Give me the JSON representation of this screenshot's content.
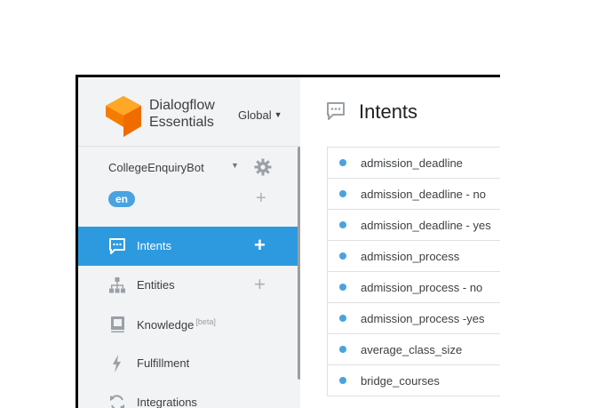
{
  "brand": {
    "line1": "Dialogflow",
    "line2": "Essentials",
    "region": "Global"
  },
  "agent": {
    "name": "CollegeEnquiryBot",
    "language": "en"
  },
  "nav": [
    {
      "label": "Intents",
      "beta": "",
      "icon": "speech-bubble-icon",
      "has_add": true,
      "active": true
    },
    {
      "label": "Entities",
      "beta": "",
      "icon": "hierarchy-icon",
      "has_add": true,
      "active": false
    },
    {
      "label": "Knowledge",
      "beta": "[beta]",
      "icon": "book-icon",
      "has_add": false,
      "active": false
    },
    {
      "label": "Fulfillment",
      "beta": "",
      "icon": "lightning-icon",
      "has_add": false,
      "active": false
    },
    {
      "label": "Integrations",
      "beta": "",
      "icon": "sync-icon",
      "has_add": false,
      "active": false
    }
  ],
  "main": {
    "title": "Intents"
  },
  "intents": [
    "admission_deadline",
    "admission_deadline - no",
    "admission_deadline - yes",
    "admission_process",
    "admission_process - no",
    "admission_process -yes",
    "average_class_size",
    "bridge_courses"
  ],
  "colors": {
    "accent": "#2d9ae0",
    "logo": "#f57c00",
    "sidebar_bg": "#f1f3f4",
    "dot": "#4aa3e0"
  }
}
